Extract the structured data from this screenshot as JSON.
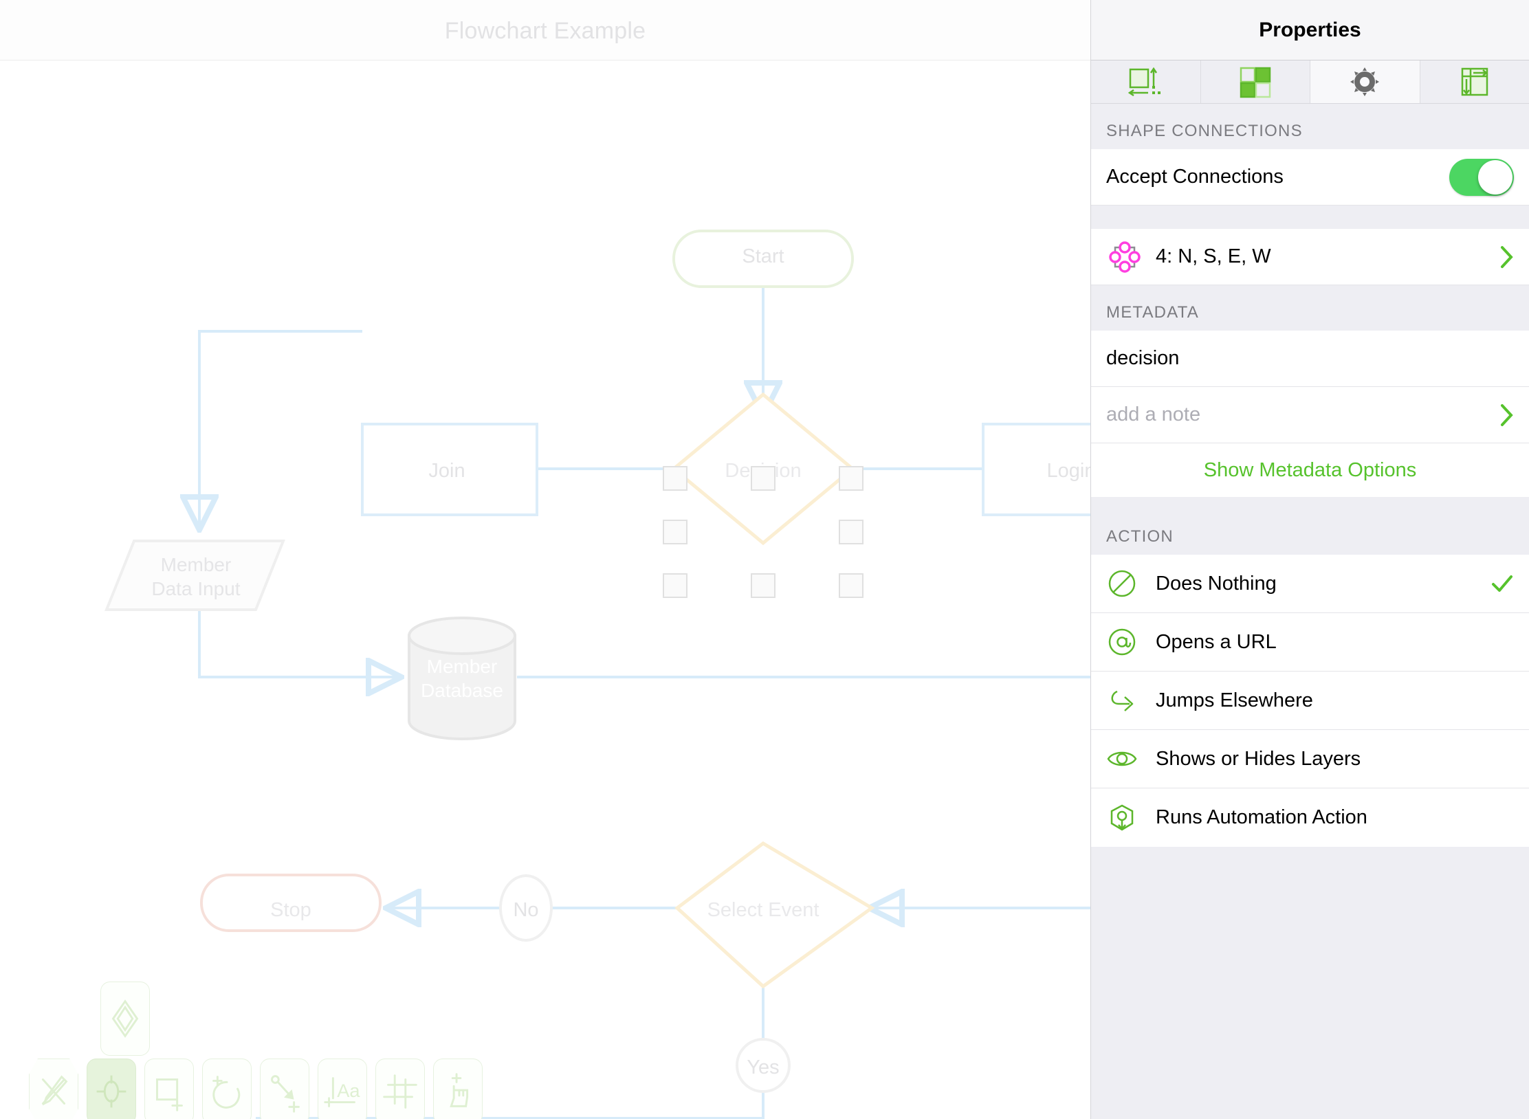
{
  "document": {
    "title": "Flowchart Example"
  },
  "panel": {
    "title": "Properties",
    "tabs": [
      {
        "name": "geometry",
        "icon": "size-geometry-icon",
        "active": false
      },
      {
        "name": "fill-stroke",
        "icon": "fill-pattern-icon",
        "active": false
      },
      {
        "name": "settings",
        "icon": "gear-icon",
        "active": true
      },
      {
        "name": "layout",
        "icon": "text-layout-icon",
        "active": false
      }
    ],
    "shape_connections": {
      "header": "SHAPE CONNECTIONS",
      "accept_connections_label": "Accept Connections",
      "accept_connections_on": true,
      "connection_points_value": "4: N, S, E, W",
      "connection_points_icon": "connection-points-icon"
    },
    "metadata": {
      "header": "METADATA",
      "name_value": "decision",
      "note_placeholder": "add a note",
      "show_options_label": "Show Metadata Options"
    },
    "action": {
      "header": "ACTION",
      "items": [
        {
          "label": "Does Nothing",
          "icon": "no-action-icon",
          "selected": true
        },
        {
          "label": "Opens a URL",
          "icon": "at-sign-icon",
          "selected": false
        },
        {
          "label": "Jumps Elsewhere",
          "icon": "jump-arrow-icon",
          "selected": false
        },
        {
          "label": "Shows or Hides Layers",
          "icon": "eye-icon",
          "selected": false
        },
        {
          "label": "Runs Automation Action",
          "icon": "automation-icon",
          "selected": false
        }
      ]
    }
  },
  "toolbar": {
    "items": [
      {
        "name": "pen-disabled-tool",
        "label": "Pen (off)",
        "active": false
      },
      {
        "name": "select-tool",
        "label": "Select",
        "active": true
      },
      {
        "name": "rectangle-tool",
        "label": "Rectangle",
        "active": false
      },
      {
        "name": "ellipse-tool",
        "label": "Ellipse",
        "active": false
      },
      {
        "name": "line-tool",
        "label": "Line",
        "active": false
      },
      {
        "name": "text-tool",
        "label": "Text",
        "active": false
      },
      {
        "name": "crop-tool",
        "label": "Crop",
        "active": false
      },
      {
        "name": "touch-tool",
        "label": "Touch",
        "active": false
      }
    ],
    "popover": {
      "name": "shape-style-popover",
      "label": "Diamond shape style"
    }
  },
  "canvas": {
    "shapes": [
      {
        "id": "start",
        "label": "Start",
        "type": "rounded-rect",
        "stroke": "#e8f2dd"
      },
      {
        "id": "join",
        "label": "Join",
        "type": "rect",
        "stroke": "#dcedf9"
      },
      {
        "id": "decision",
        "label": "Decision",
        "type": "diamond",
        "stroke": "#fbeed2",
        "selected": true
      },
      {
        "id": "login",
        "label": "Login",
        "type": "rect",
        "stroke": "#dcedf9"
      },
      {
        "id": "member-data",
        "label": "Member\nData Input",
        "type": "parallelogram",
        "stroke": "#efefef"
      },
      {
        "id": "member-db",
        "label": "Member\nDatabase",
        "type": "cylinder",
        "stroke": "#e6e6e6"
      },
      {
        "id": "stop",
        "label": "Stop",
        "type": "rounded-rect",
        "stroke": "#f6e0da"
      },
      {
        "id": "no",
        "label": "No",
        "type": "ellipse",
        "stroke": "#f0f0f0"
      },
      {
        "id": "select-event",
        "label": "Select Event",
        "type": "diamond",
        "stroke": "#fbeed2"
      },
      {
        "id": "yes",
        "label": "Yes",
        "type": "circle",
        "stroke": "#f0f0f0"
      }
    ],
    "shape_labels": {
      "start": "Start",
      "join": "Join",
      "decision": "Decision",
      "login": "Login",
      "member_data_line1": "Member",
      "member_data_line2": "Data Input",
      "member_db_line1": "Member",
      "member_db_line2": "Database",
      "stop": "Stop",
      "no": "No",
      "select_event": "Select Event",
      "yes": "Yes"
    },
    "connector_color": "#d7ebf9",
    "selection_handle_count": 8
  },
  "colors": {
    "accent_green": "#56c22c",
    "toggle_green": "#4cd662",
    "magenta": "#ff3fe0",
    "panel_bg": "#eeeef3",
    "row_bg": "#ffffff",
    "connector": "#d7ebf9",
    "decision_stroke": "#fbeed2"
  }
}
